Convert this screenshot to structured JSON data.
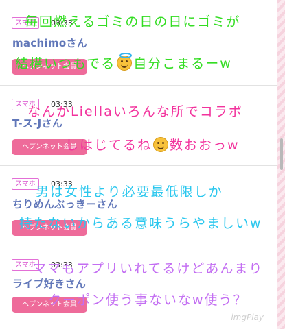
{
  "posts": [
    {
      "badge": "スマホ",
      "time": "03:33",
      "user": "machimoさん",
      "member_label": "ヘブンネット会員",
      "overlay": [
        "毎回燃えるゴミの日の日にゴミが",
        "結構いつもでる",
        "自分こまるーw"
      ]
    },
    {
      "badge": "スマホ",
      "time": "03:33",
      "user": "T-ス-Jさん",
      "member_label": "ヘブンネット会員",
      "overlay": [
        "なんかLiellaいろんな所でコラボ",
        "しはじてるね",
        "数おおっw"
      ]
    },
    {
      "badge": "スマホ",
      "time": "03:33",
      "user": "ちりめんぶっきーさん",
      "member_label": "ヘブンネット会員",
      "overlay": [
        "男は女性より必要最低限しか",
        "持たないからある意味うらやましいw"
      ]
    },
    {
      "badge": "スマホ",
      "time": "03:33",
      "user": "ライブ好きさん",
      "member_label": "ヘブンネット会員",
      "overlay": [
        "ママもアプリいれてるけどあんまり",
        "クーポン使う事ないなw使う？"
      ]
    }
  ],
  "watermark": "imgPlay"
}
